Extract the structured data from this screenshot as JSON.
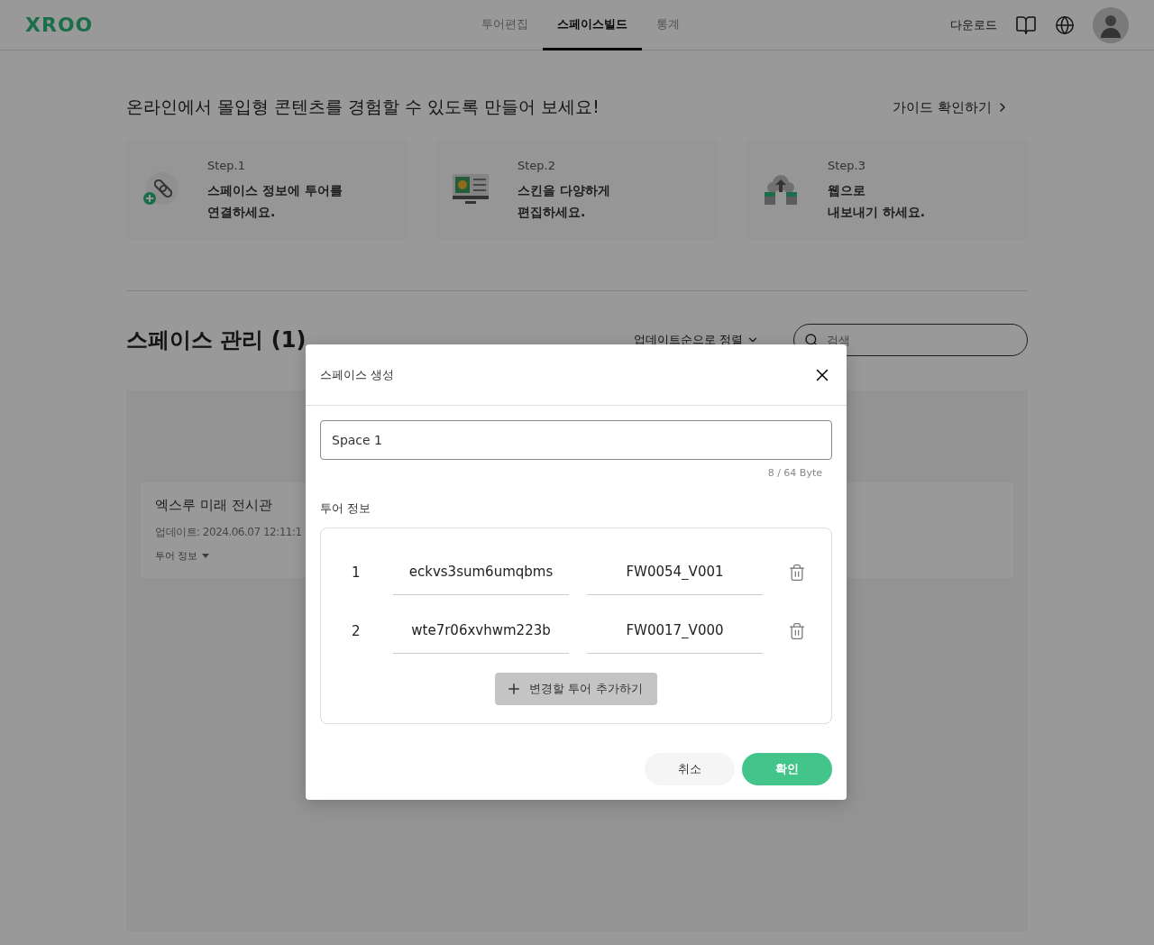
{
  "header": {
    "logo": "XROO",
    "nav": [
      {
        "label": "투어편집",
        "selected": false
      },
      {
        "label": "스페이스빌드",
        "selected": true
      },
      {
        "label": "통계",
        "selected": false
      }
    ],
    "download": "다운로드"
  },
  "intro": {
    "headline": "온라인에서 몰입형 콘텐츠를 경험할 수 있도록 만들어 보세요!",
    "guide_link": "가이드 확인하기"
  },
  "steps": [
    {
      "kind": "link",
      "step": "Step.1",
      "lines": [
        "스페이스 정보에 투어를",
        "연결하세요."
      ]
    },
    {
      "kind": "skin",
      "step": "Step.2",
      "lines": [
        "스킨을 다양하게",
        "편집하세요."
      ]
    },
    {
      "kind": "export",
      "step": "Step.3",
      "lines": [
        "웹으로",
        "내보내기 하세요."
      ]
    }
  ],
  "spaces": {
    "title": "스페이스 관리 (1)",
    "sort": "업데이트순으로 정렬",
    "search_placeholder": "검색",
    "cards": [
      {
        "name": "엑스루 미래 전시관",
        "updated": "업데이트: 2024.06.07 12:11:1",
        "tour_info": "투어 정보"
      }
    ]
  },
  "dialog": {
    "title": "스페이스 생성",
    "name_value": "Space 1",
    "byte_count": "8 / 64 Byte",
    "section_label": "투어 정보",
    "tours": [
      {
        "index": "1",
        "tour_id": "eckvs3sum6umqbms",
        "tour_code": "FW0054_V001"
      },
      {
        "index": "2",
        "tour_id": "wte7r06xvhwm223b",
        "tour_code": "FW0017_V000"
      }
    ],
    "add_button": "변경할 투어 추가하기",
    "cancel": "취소",
    "confirm": "확인"
  }
}
